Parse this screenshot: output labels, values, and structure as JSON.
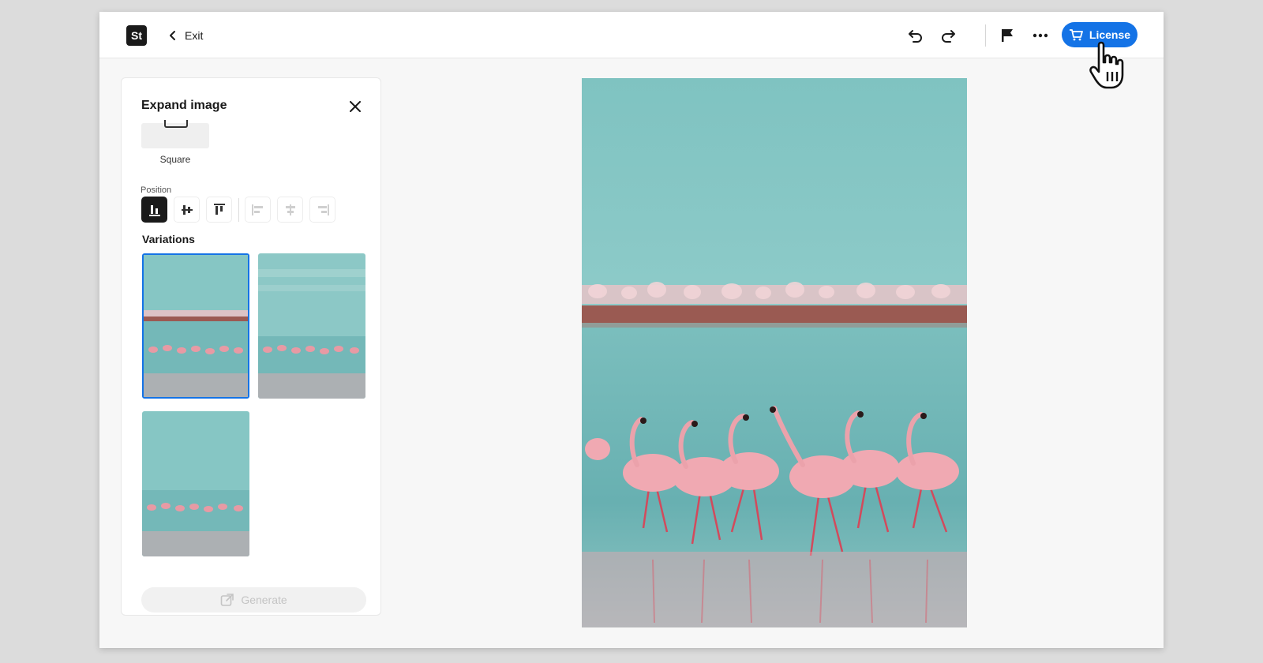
{
  "app": {
    "logo_text": "St",
    "exit_label": "Exit"
  },
  "toolbar": {
    "license_label": "License",
    "icons": [
      "undo-icon",
      "redo-icon",
      "flag-icon",
      "more-icon",
      "cart-icon"
    ]
  },
  "panel": {
    "title": "Expand image",
    "aspect_label": "Square",
    "position_label": "Position",
    "position_options": [
      "bottom",
      "center",
      "top",
      "left",
      "middle",
      "right"
    ],
    "selected_position": "bottom",
    "variations_label": "Variations",
    "variations_count": 3,
    "selected_variation": 1,
    "generate_label": "Generate"
  },
  "colors": {
    "accent": "#1473e6",
    "sky": "#86c6c4",
    "water": "#6fb5b5",
    "flamingo": "#e8a0a8",
    "flamingo_dark": "#c44a55"
  }
}
